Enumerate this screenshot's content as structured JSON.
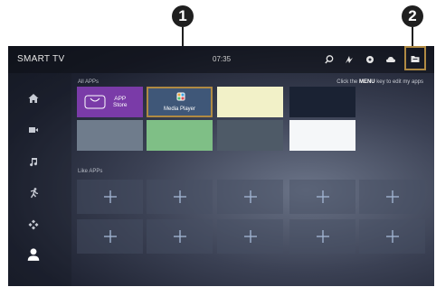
{
  "callouts": [
    "1",
    "2"
  ],
  "topbar": {
    "brand": "SMART TV",
    "time": "07:35",
    "icons": [
      "search-icon",
      "signal-icon",
      "settings-icon",
      "cloud-icon",
      "folder-icon"
    ]
  },
  "sidebar": {
    "icons": [
      "home-icon",
      "video-icon",
      "music-icon",
      "sports-icon",
      "apps-icon",
      "user-icon"
    ],
    "active": "user-icon"
  },
  "all_apps": {
    "label": "All APPs",
    "hint_prefix": "Click the",
    "hint_key": "MENU",
    "hint_suffix": "key to edit my apps",
    "tiles": [
      {
        "name": "APP Store",
        "line1": "APP",
        "line2": "Store",
        "color": "#7a3ba8",
        "icon": "store-bag-icon"
      },
      {
        "name": "Media Player",
        "label": "Media Player",
        "color": "#3f5778",
        "icon": "media-player-icon",
        "highlighted": true
      },
      {
        "color": "#f2f1c8"
      },
      {
        "color": "#1a2233"
      },
      {
        "color": "#6f7c8c"
      },
      {
        "color": "#7fbf86"
      },
      {
        "color": "#4e5a67"
      },
      {
        "color": "#f5f7f9"
      }
    ]
  },
  "like_apps": {
    "label": "Like APPs",
    "slots": 10
  },
  "colors": {
    "highlight_border": "#b08a43",
    "callout_bg": "#1f1f1f"
  }
}
